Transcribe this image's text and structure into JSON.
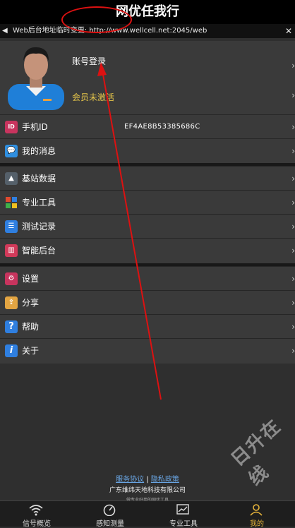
{
  "header": {
    "title": "网优任我行"
  },
  "notice": {
    "text": "Web后台地址临时变更: http://www.wellcell.net:2045/web",
    "speaker_icon": "speaker-icon",
    "close_icon": "close-icon"
  },
  "profile": {
    "account_login": "账号登录",
    "member_status": "会员未激活",
    "avatar_icon": "avatar"
  },
  "group1": [
    {
      "label": "手机ID",
      "value": "EF4AE8B53385686C",
      "icon": "id-icon",
      "color": "#c8345e"
    },
    {
      "label": "我的消息",
      "value": "",
      "icon": "message-icon",
      "color": "#2f8fe0"
    }
  ],
  "group2": [
    {
      "label": "基站数据",
      "icon": "tower-icon",
      "color": "#55606a"
    },
    {
      "label": "专业工具",
      "icon": "grid-icon",
      "color": "#e04a2f"
    },
    {
      "label": "测试记录",
      "icon": "list-icon",
      "color": "#2f7fe0"
    },
    {
      "label": "智能后台",
      "icon": "chart-icon",
      "color": "#d23a5a"
    }
  ],
  "group3": [
    {
      "label": "设置",
      "icon": "gear-icon",
      "color": "#c8345e"
    },
    {
      "label": "分享",
      "icon": "share-icon",
      "color": "#e3a542"
    },
    {
      "label": "帮助",
      "icon": "help-icon",
      "color": "#2f7fe0"
    },
    {
      "label": "关于",
      "icon": "info-icon",
      "color": "#2f7fe0"
    }
  ],
  "footer": {
    "service_agreement": "服务协议",
    "divider": "|",
    "privacy_policy": "隐私政策",
    "company": "广东维纬天地科技有限公司",
    "slogan": "做专业好用的网优工具"
  },
  "watermark": "日升在线",
  "tabs": [
    {
      "label": "信号概览",
      "icon": "wifi-icon"
    },
    {
      "label": "感知测量",
      "icon": "gauge-icon"
    },
    {
      "label": "专业工具",
      "icon": "tools-icon"
    },
    {
      "label": "我的",
      "icon": "person-icon",
      "active": true
    }
  ],
  "colors": {
    "accent": "#e5b33a",
    "annotation": "#dd1111",
    "link": "#6aa7e6"
  }
}
